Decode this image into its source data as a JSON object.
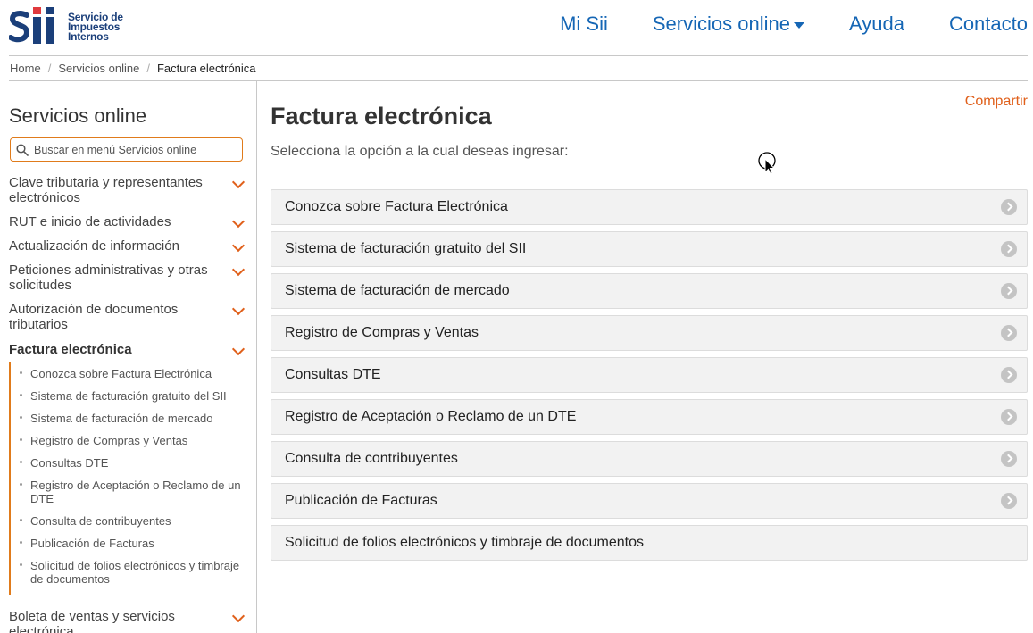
{
  "header": {
    "logo_lines": [
      "Servicio de",
      "Impuestos",
      "Internos"
    ],
    "nav": [
      {
        "label": "Mi Sii"
      },
      {
        "label": "Servicios online"
      },
      {
        "label": "Ayuda"
      },
      {
        "label": "Contacto"
      }
    ]
  },
  "breadcrumb": [
    "Home",
    "Servicios online",
    "Factura electrónica"
  ],
  "sidebar": {
    "title": "Servicios online",
    "search_placeholder": "Buscar en menú Servicios online",
    "sections": [
      {
        "label": "Clave tributaria y representantes electrónicos"
      },
      {
        "label": "RUT e inicio de actividades"
      },
      {
        "label": "Actualización de información"
      },
      {
        "label": "Peticiones administrativas y otras solicitudes"
      },
      {
        "label": "Autorización de documentos tributarios"
      },
      {
        "label": "Factura electrónica"
      },
      {
        "label": "Boleta de ventas y servicios electrónica"
      }
    ],
    "submenu": [
      "Conozca sobre Factura Electrónica",
      "Sistema de facturación gratuito del SII",
      "Sistema de facturación de mercado",
      "Registro de Compras y Ventas",
      "Consultas DTE",
      "Registro de Aceptación o Reclamo de un DTE",
      "Consulta de contribuyentes",
      "Publicación de Facturas",
      "Solicitud de folios electrónicos y timbraje de documentos"
    ]
  },
  "main": {
    "title": "Factura electrónica",
    "share": "Compartir",
    "subtitle": "Selecciona la opción a la cual deseas ingresar:",
    "options": [
      "Conozca sobre Factura Electrónica",
      "Sistema de facturación gratuito del SII",
      "Sistema de facturación de mercado",
      "Registro de Compras y Ventas",
      "Consultas DTE",
      "Registro de Aceptación o Reclamo de un DTE",
      "Consulta de contribuyentes",
      "Publicación de Facturas",
      "Solicitud de folios electrónicos y timbraje de documentos"
    ]
  },
  "colors": {
    "brand_blue": "#1566b5",
    "accent_orange": "#e0601b",
    "logo_red": "#e03a3e",
    "logo_navy": "#1b3f7a"
  }
}
